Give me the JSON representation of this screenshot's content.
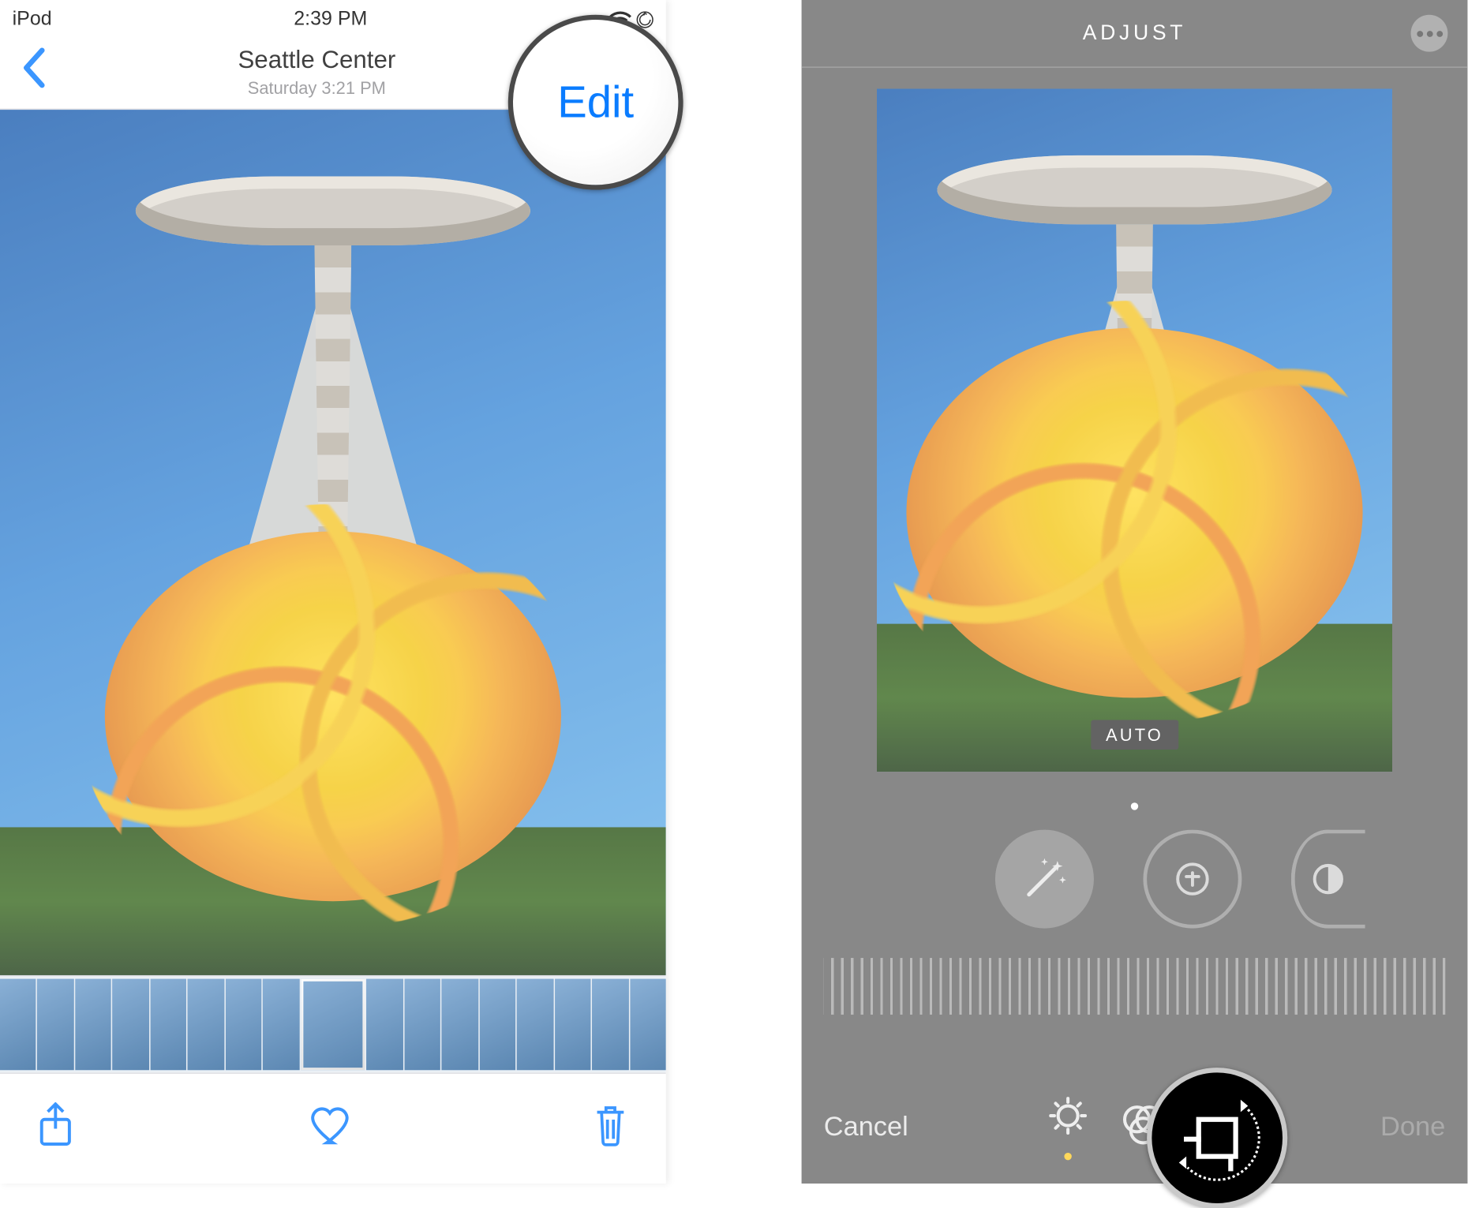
{
  "left": {
    "statusbar": {
      "device": "iPod",
      "time": "2:39 PM"
    },
    "nav": {
      "title": "Seattle Center",
      "subtitle": "Saturday  3:21 PM",
      "edit": "Edit"
    },
    "toolbar": {
      "share": "share",
      "favorite": "favorite",
      "trash": "trash"
    }
  },
  "right": {
    "header": {
      "title": "ADJUST",
      "more": "more"
    },
    "auto_label": "AUTO",
    "adjust_tools": {
      "wand": "auto-enhance",
      "exposure": "exposure",
      "contrast": "contrast"
    },
    "bottom": {
      "cancel": "Cancel",
      "done": "Done",
      "tabs": {
        "adjust": "adjust",
        "filters": "filters",
        "crop": "crop"
      }
    }
  },
  "callouts": {
    "edit": "Edit",
    "crop": "crop-rotate"
  }
}
